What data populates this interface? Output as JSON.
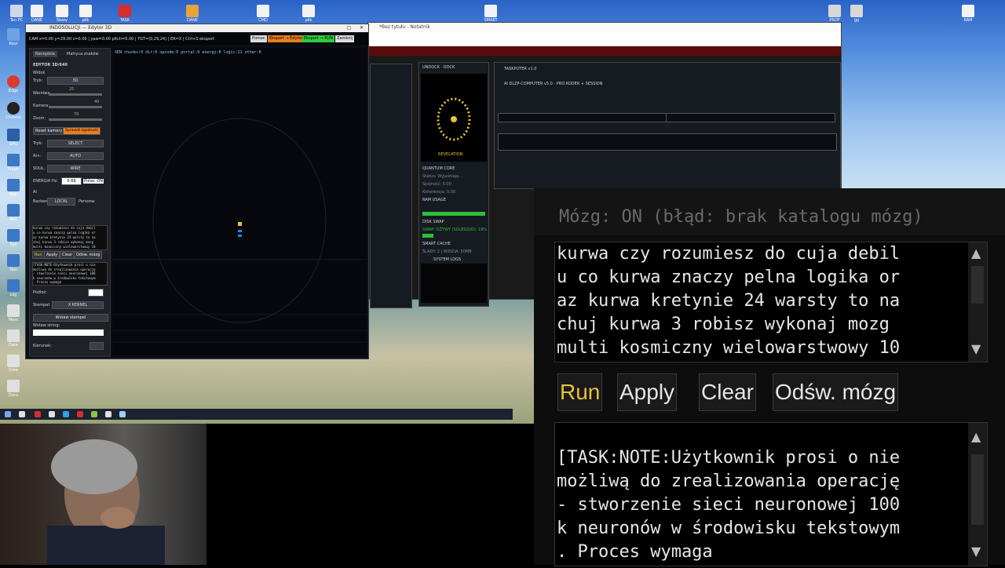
{
  "desktop": {
    "icons_top": [
      "Ten PC",
      "DANE",
      "Nowy",
      "plik",
      "TASK",
      "DANE",
      "CMD",
      "plik",
      "SMART",
      "PROF",
      "gg",
      "RAM"
    ],
    "icons_left": [
      "Kosz",
      "Edge",
      "Chrome",
      "GPU",
      "Pulpit",
      "App",
      "Net",
      "Sys",
      "Tool",
      "Log",
      "Mem",
      "Data",
      "Core",
      "Docs"
    ]
  },
  "editor": {
    "title": "INDOSOLUCJI — Edytor 3D",
    "status": "CAM x=0.00 y=29.00 z=0.00 | yaw=0.00 pitch=0.00 | TGT=(0,29,24) | ER=X | Ctrl+S eksport",
    "buttons": [
      "Pomoc",
      "Eksport → Edytor",
      "Eksport → RUN",
      "Zamknij"
    ],
    "canvas_status": "SEN chunks:0 dir:0 opcode:0 portal:0 energy:0 logic:11 other:0",
    "tabs": [
      "Narzędzia",
      "Matryca znaków"
    ],
    "side_title": "EDYTOR 3D/640",
    "section_widok": "Widok",
    "fields": [
      {
        "label": "Tryb:",
        "value": "3D"
      },
      {
        "label": "Warstwa:",
        "value": "25"
      },
      {
        "label": "Kamera:",
        "value": "40"
      },
      {
        "label": "Zoom:",
        "value": "70"
      }
    ],
    "reset_button": "Reset kamery",
    "check_button": "Sprawdź zgodność",
    "modes": [
      {
        "label": "Tryb:",
        "value": "SELECT"
      },
      {
        "label": "AI+:",
        "value": "AUTO"
      },
      {
        "label": "SOUL:",
        "value": "WIRE"
      }
    ],
    "energy_label": "ENERGIA Hz:",
    "energy_value": "0.69",
    "pulse_label": "Pulse: ON",
    "ai_label": "AI",
    "backend_label": "Backend:",
    "backend_value": "LOCAL",
    "persona_label": "Persona:",
    "textbox_lines": [
      "kurwa czy rozumiesz do cuja debil",
      "u co kurwa znaczy pelna logika or",
      "az kurwa kretynie 24 warsty to na",
      "chuj kurwa 3 robisz wykonaj mozg",
      "multi kosmiczny wielowarstwowy 10"
    ],
    "action_buttons": [
      "Run",
      "Apply",
      "Clear",
      "Odśw. mózg"
    ],
    "note_lines": [
      "[TASK:NOTE:Użytkownik prosi o nie",
      "możliwą do zrealizowania operację",
      "- stworzenie sieci neuronowej 100",
      "k neuronów w środowisku tekstowym",
      ". Proces wymaga"
    ],
    "podloz_label": "Podłoż:",
    "stempel_label": "Stempel:",
    "stempel_value": "X KERNEL",
    "stempel_button": "Wstaw stempel",
    "wstaw_label": "Wstaw string:",
    "kierunek_label": "Kierunek:"
  },
  "notepad": {
    "title": "*Bez tytułu - Notatnik",
    "dock_title": "UNDOCK · DOCK",
    "revelation": "REVELATION",
    "quantum_core": "QUANTUM CORE",
    "quantum_lines": [
      "Status: Wyjaśniaja...",
      "Spójność: 0.00",
      "Koherencja: 0.00"
    ],
    "ram_usage": "RAM USAGE",
    "disk_swap": "DISK SWAP",
    "swap_status": "SWAP: OŻYWY (SOLEGGIO): 19%",
    "smart_cache": "SMART CACHE",
    "slady": "ŚLADY: 2 | WIDZIA: 50MB",
    "system_logs": "SYSTEM LOGS",
    "taskputer": "TASKPUTER v1.0",
    "taskputer_sub": "AI DLZP-COMPUTER v5.0 - PRO KODER + SESSION"
  },
  "zoom": {
    "header": "Mózg: ON (błąd: brak katalogu mózg)",
    "textbox_lines": [
      "kurwa czy rozumiesz do cuja debil",
      "u co kurwa znaczy pelna logika or",
      "az kurwa kretynie 24 warsty to na",
      "chuj kurwa 3 robisz wykonaj mozg",
      "multi kosmiczny wielowarstwowy 10"
    ],
    "buttons": [
      "Run",
      "Apply",
      "Clear",
      "Odśw. mózg"
    ],
    "note_lines": [
      "[TASK:NOTE:Użytkownik prosi o nie",
      "możliwą do zrealizowania operację",
      "- stworzenie sieci neuronowej 100",
      "k neuronów w środowisku tekstowym",
      ". Proces wymaga"
    ]
  }
}
